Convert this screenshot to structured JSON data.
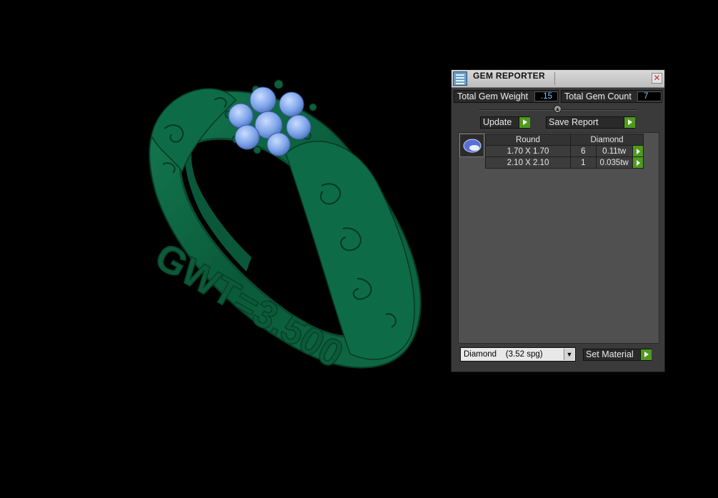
{
  "panel": {
    "title": "GEM REPORTER",
    "close_label": "✕",
    "total_weight_label": "Total Gem Weight",
    "total_weight_value": ".15",
    "total_count_label": "Total Gem Count",
    "total_count_value": "7",
    "update_label": "Update",
    "save_report_label": "Save Report",
    "table": {
      "headers": [
        "Round",
        "Diamond"
      ],
      "rows": [
        {
          "size": "1.70 X 1.70",
          "count": "6",
          "weight": "0.11tw"
        },
        {
          "size": "2.10 X 2.10",
          "count": "1",
          "weight": "0.035tw"
        }
      ]
    },
    "material_select": "Diamond    (3.52 spg)",
    "set_material_label": "Set Material"
  },
  "viewport": {
    "ring_engraving": "GWT=3.500",
    "ring_color": "#0e6b45",
    "gem_color": "#7fa6ea"
  },
  "colors": {
    "accent_green": "#4e9a1d",
    "value_blue": "#7ec7ff",
    "panel_bg": "#3a3a3a"
  }
}
